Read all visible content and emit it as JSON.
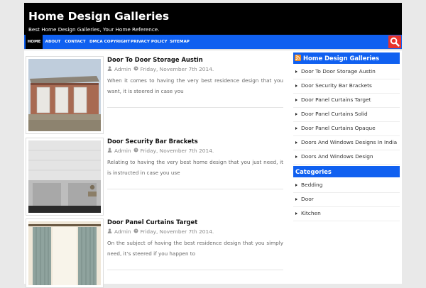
{
  "header": {
    "title": "Home Design Galleries",
    "tagline": "Best Home Design Galleries, Your Home Reference."
  },
  "nav": {
    "items": [
      "HOME",
      "ABOUT",
      "CONTACT",
      "DMCA COPYRIGHT",
      "PRIVACY POLICY",
      "SITEMAP"
    ],
    "active": "HOME",
    "search_icon": "search-icon"
  },
  "posts": [
    {
      "title": "Door To Door Storage Austin",
      "author": "Admin",
      "date": "Friday, November 7th 2014.",
      "excerpt": "When it comes to having the very best residence design that you want, it is steered in case you"
    },
    {
      "title": "Door Security Bar Brackets",
      "author": "Admin",
      "date": "Friday, November 7th 2014.",
      "excerpt": "Relating to having the very best home design that you just need, it is instructed in case you use"
    },
    {
      "title": "Door Panel Curtains Target",
      "author": "Admin",
      "date": "Friday, November 7th 2014.",
      "excerpt": "On the subject of having the best residence design that you simply need, it’s steered if you happen to"
    }
  ],
  "sidebar": {
    "feed_widget": {
      "title": "Home Design Galleries",
      "items": [
        "Door To Door Storage Austin",
        "Door Security Bar Brackets",
        "Door Panel Curtains Target",
        "Door Panel Curtains Solid",
        "Door Panel Curtains Opaque",
        "Doors And Windows Designs In India",
        "Doors And Windows Design"
      ]
    },
    "categories_widget": {
      "title": "Categories",
      "items": [
        "Bedding",
        "Door",
        "Kitchen"
      ]
    }
  },
  "colors": {
    "brand_blue": "#1060f0",
    "header_black": "#000000",
    "search_red": "#e8322c"
  }
}
